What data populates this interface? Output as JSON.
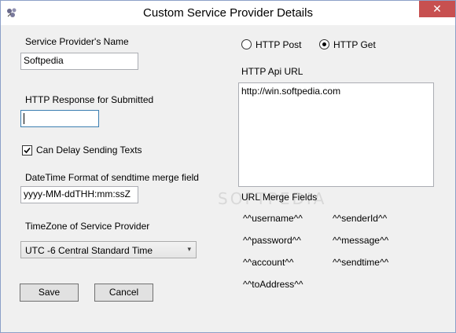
{
  "window": {
    "title": "Custom Service Provider Details",
    "close_glyph": "✕"
  },
  "left": {
    "name_label": "Service Provider's Name",
    "name_value": "Softpedia",
    "http_response_label": "HTTP Response for Submitted",
    "http_response_value": "",
    "delay_label": "Can Delay Sending Texts",
    "delay_checked": true,
    "datetime_label": "DateTime Format of sendtime merge field",
    "datetime_value": "yyyy-MM-ddTHH:mm:ssZ",
    "timezone_label": "TimeZone of Service Provider",
    "timezone_value": "UTC -6 Central Standard Time"
  },
  "right": {
    "http_post_label": "HTTP Post",
    "http_get_label": "HTTP Get",
    "selected_method": "HTTP Get",
    "api_url_label": "HTTP Api URL",
    "api_url_value": "http://win.softpedia.com",
    "merge_fields_label": "URL Merge Fields",
    "merge_fields": [
      "^^username^^",
      "^^senderId^^",
      "^^password^^",
      "^^message^^",
      "^^account^^",
      "^^sendtime^^",
      "^^toAddress^^"
    ]
  },
  "buttons": {
    "save_label": "Save",
    "cancel_label": "Cancel"
  },
  "watermark": "SOFTPEDIA",
  "icons": {
    "app": "app-icon",
    "checkbox_mark": "checkmark-icon",
    "dropdown": "chevron-down-icon"
  },
  "colors": {
    "close_button": "#c75050",
    "focus_border": "#3c7fb1"
  }
}
